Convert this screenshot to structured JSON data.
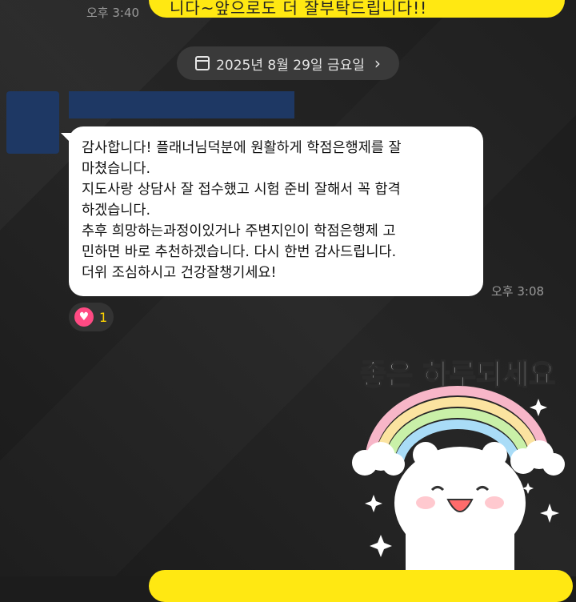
{
  "chat": {
    "top_partial_text": "니다~앞으로도 더 잘부탁드립니다!!",
    "top_time": "오후 3:40",
    "date_label": "2025년 8월 29일 금요일",
    "message_lines": [
      "감사합니다! 플래너님덕분에 원활하게 학점은행제를 잘",
      "마쳤습니다.",
      "지도사랑 상담사 잘 접수했고 시험 준비 잘해서 꼭 합격",
      "하겠습니다.",
      "추후 희망하는과정이있거나 주변지인이 학점은행제 고",
      "민하면 바로 추천하겠습니다. 다시 한번 감사드립니다.",
      "더위 조심하시고 건강잘챙기세요!"
    ],
    "message_time": "오후 3:08",
    "reaction_count": "1",
    "sticker_text": "좋은 하루되세요"
  },
  "icons": {
    "calendar": "calendar-icon",
    "chevron": "chevron-right-icon",
    "heart": "heart-icon"
  },
  "colors": {
    "my_bubble": "#ffe812",
    "other_bubble": "#ffffff",
    "background": "#1c1c1c",
    "heart": "#ff4a83",
    "reaction_count": "#ffd400"
  }
}
